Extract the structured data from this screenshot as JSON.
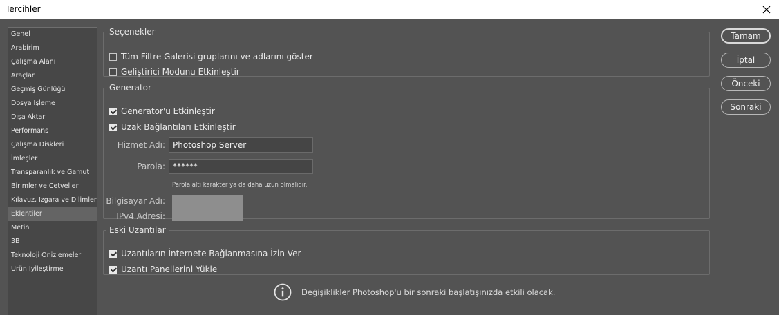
{
  "window": {
    "title": "Tercihler"
  },
  "sidebar": {
    "items": [
      {
        "label": "Genel"
      },
      {
        "label": "Arabirim"
      },
      {
        "label": "Çalışma Alanı"
      },
      {
        "label": "Araçlar"
      },
      {
        "label": "Geçmiş Günlüğü"
      },
      {
        "label": "Dosya İşleme"
      },
      {
        "label": "Dışa Aktar"
      },
      {
        "label": "Performans"
      },
      {
        "label": "Çalışma Diskleri"
      },
      {
        "label": "İmleçler"
      },
      {
        "label": "Transparanlık ve Gamut"
      },
      {
        "label": "Birimler ve Cetveller"
      },
      {
        "label": "Kılavuz, Izgara ve Dilimler"
      },
      {
        "label": "Eklentiler",
        "selected": true
      },
      {
        "label": "Metin"
      },
      {
        "label": "3B"
      },
      {
        "label": "Teknoloji Önizlemeleri"
      },
      {
        "label": "Ürün İyileştirme"
      }
    ]
  },
  "options": {
    "legend": "Seçenekler",
    "show_filter_gallery": {
      "label": "Tüm Filtre Galerisi gruplarını ve adlarını göster",
      "checked": false
    },
    "developer_mode": {
      "label": "Geliştirici Modunu Etkinleştir",
      "checked": false
    }
  },
  "generator": {
    "legend": "Generator",
    "enable_generator": {
      "label": "Generator'u Etkinleştir",
      "checked": true
    },
    "enable_remote": {
      "label": "Uzak Bağlantıları Etkinleştir",
      "checked": true
    },
    "service_name_label": "Hizmet Adı:",
    "service_name_value": "Photoshop Server",
    "password_label": "Parola:",
    "password_value": "******",
    "password_hint": "Parola altı karakter ya da daha uzun olmalıdır.",
    "computer_name_label": "Bilgisayar Adı:",
    "ipv4_label": "IPv4 Adresi:"
  },
  "legacy": {
    "legend": "Eski Uzantılar",
    "allow_internet": {
      "label": "Uzantıların İnternete Bağlanmasına İzin Ver",
      "checked": true
    },
    "load_panels": {
      "label": "Uzantı Panellerini Yükle",
      "checked": true
    }
  },
  "buttons": {
    "ok": "Tamam",
    "cancel": "İptal",
    "prev": "Önceki",
    "next": "Sonraki"
  },
  "info": {
    "icon": "info-icon",
    "message": "Değişiklikler Photoshop'u bir sonraki başlatışınızda etkili olacak."
  }
}
